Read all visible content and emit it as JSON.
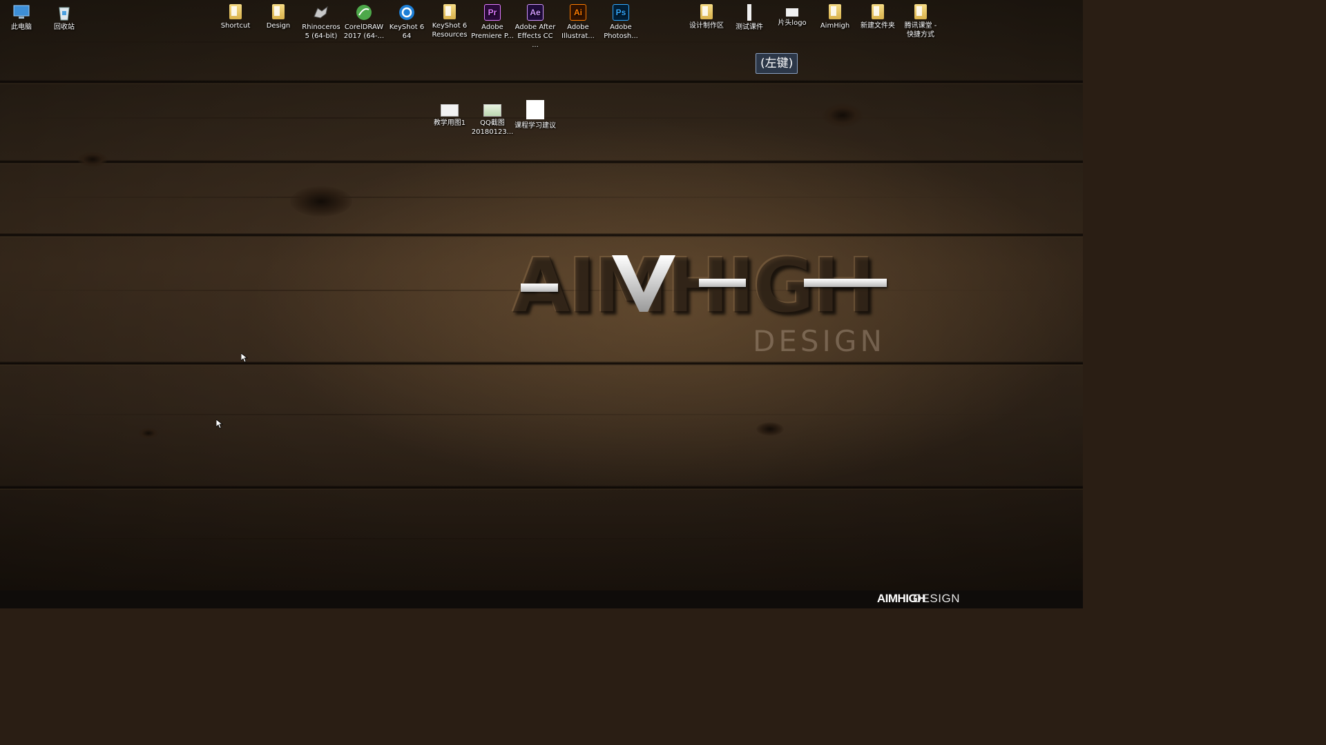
{
  "desktop_icons": [
    {
      "label": "此电脑",
      "icon": "computer-icon"
    },
    {
      "label": "回收站",
      "icon": "recycle-bin-icon"
    },
    {
      "label": "Shortcut",
      "icon": "folder-icon"
    },
    {
      "label": "Design",
      "icon": "folder-icon"
    },
    {
      "label": "Rhinoceros\n5 (64-bit)",
      "icon": "rhinoceros-icon"
    },
    {
      "label": "CorelDRAW\n2017 (64-...",
      "icon": "coreldraw-icon"
    },
    {
      "label": "KeyShot 6\n64",
      "icon": "keyshot-icon"
    },
    {
      "label": "KeyShot 6\nResources",
      "icon": "folder-icon"
    },
    {
      "label": "Adobe\nPremiere P...",
      "icon": "premiere-icon",
      "abbr": "Pr"
    },
    {
      "label": "Adobe After\nEffects CC ...",
      "icon": "after-effects-icon",
      "abbr": "Ae"
    },
    {
      "label": "Adobe\nIllustrat...",
      "icon": "illustrator-icon",
      "abbr": "Ai"
    },
    {
      "label": "Adobe\nPhotosh...",
      "icon": "photoshop-icon",
      "abbr": "Ps"
    },
    {
      "label": "设计制作区",
      "icon": "folder-icon"
    },
    {
      "label": "测试课件",
      "icon": "folder-icon"
    },
    {
      "label": "片头logo",
      "icon": "image-file-icon"
    },
    {
      "label": "AimHigh",
      "icon": "folder-icon"
    },
    {
      "label": "新建文件夹",
      "icon": "folder-icon"
    },
    {
      "label": "腾讯课堂 -\n快捷方式",
      "icon": "folder-shortcut-icon"
    },
    {
      "label": "教学用图1",
      "icon": "image-file-icon"
    },
    {
      "label": "QQ截图\n20180123...",
      "icon": "screenshot-file-icon"
    },
    {
      "label": "课程学习建议",
      "icon": "document-icon"
    }
  ],
  "tooltip": {
    "text": "(左键)"
  },
  "wallpaper": {
    "logo_main": "AIMHIGH",
    "logo_sub": "DESIGN"
  },
  "bottom_bar": {
    "brand_bold": "AIMHIGH",
    "brand_light": "·DESIGN"
  },
  "colors": {
    "premiere": "#e07bff",
    "after_effects": "#cf96fd",
    "illustrator": "#ff7c00",
    "photoshop": "#31a8ff",
    "folder": "#e8c765",
    "tooltip_bg": "#2c3748"
  }
}
